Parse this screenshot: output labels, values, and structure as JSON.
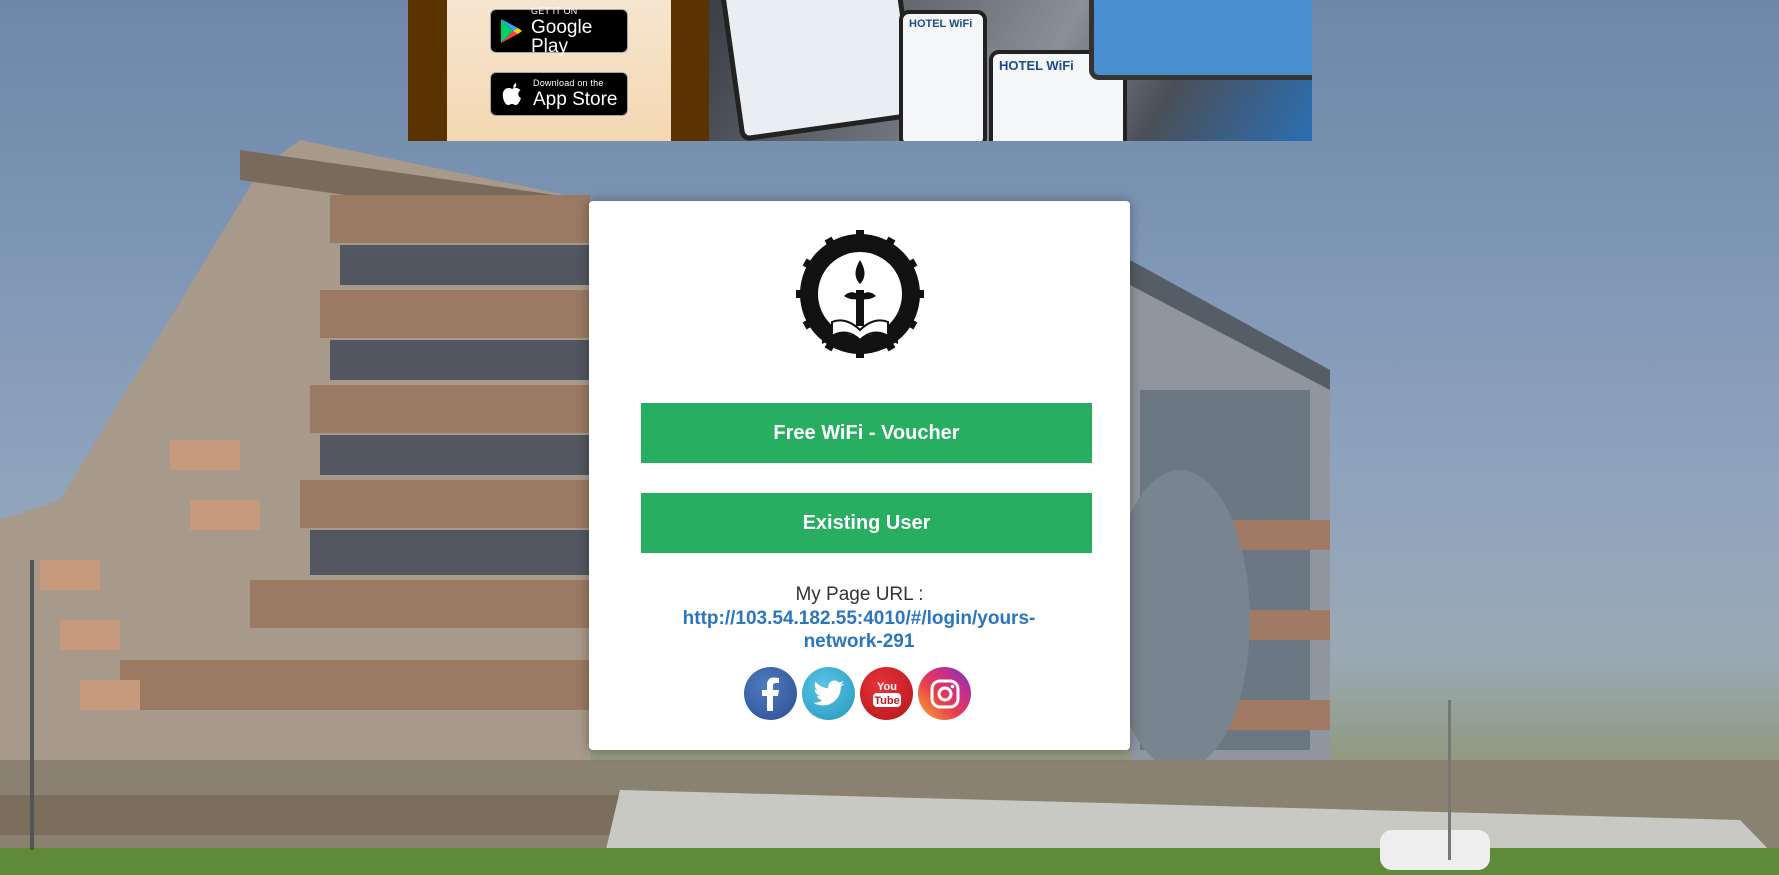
{
  "banner": {
    "google_play": {
      "small": "GET IT ON",
      "big": "Google Play"
    },
    "app_store": {
      "small": "Download on the",
      "big": "App Store"
    },
    "device_label_1": "HOTEL WiFi",
    "device_label_2": "HOTEL WiFi"
  },
  "card": {
    "logo_alt": "S.D.M INSTITUTE OF TECHNOLOGY, UJIRE",
    "voucher_button": "Free WiFi - Voucher",
    "existing_user_button": "Existing User",
    "url_label": "My Page URL :",
    "url_link": "http://103.54.182.55:4010/#/login/yours-network-291"
  },
  "socials": {
    "facebook": "facebook-icon",
    "twitter": "twitter-icon",
    "youtube": "youtube-icon",
    "instagram": "instagram-icon"
  },
  "colors": {
    "button_green": "#27ae60",
    "link_blue": "#2a76c0"
  }
}
